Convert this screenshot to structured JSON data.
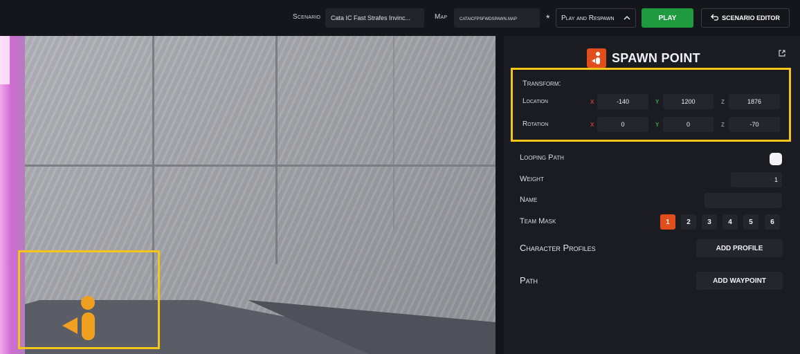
{
  "topbar": {
    "scenario_label": "Scenario",
    "scenario_value": "Cata IC Fast Strafes Invinc...",
    "map_label": "Map",
    "map_value": "cataicfpsfwdspawn.map",
    "modified_marker": "*",
    "mode_value": "Play and Respawn",
    "play_label": "PLAY",
    "editor_label": "SCENARIO EDITOR"
  },
  "panel": {
    "title": "SPAWN POINT",
    "transform_label": "Transform:",
    "location_label": "Location",
    "rotation_label": "Rotation",
    "axes": {
      "x": "X",
      "y": "Y",
      "z": "Z"
    },
    "location": {
      "x": "-140",
      "y": "1200",
      "z": "1876"
    },
    "rotation": {
      "x": "0",
      "y": "0",
      "z": "-70"
    },
    "looping_path_label": "Looping Path",
    "weight_label": "Weight",
    "weight_value": "1",
    "name_label": "Name",
    "name_value": "",
    "team_mask_label": "Team Mask",
    "team_mask_options": [
      "1",
      "2",
      "3",
      "4",
      "5",
      "6"
    ],
    "team_mask_active": "1",
    "character_profiles_label": "Character Profiles",
    "add_profile_label": "ADD PROFILE",
    "path_label": "Path",
    "add_waypoint_label": "ADD WAYPOINT"
  },
  "colors": {
    "accent": "#e24e1b",
    "play": "#1f9a3e",
    "highlight": "#f5c518",
    "axis_x": "#c23b3b",
    "axis_y": "#3fa14a",
    "axis_z": "#8a8a92"
  },
  "icons": {
    "spawn_point": "spawn-point-icon",
    "undo": "undo-arrow-icon",
    "external": "external-link-icon",
    "chevron": "chevron-up-icon"
  }
}
